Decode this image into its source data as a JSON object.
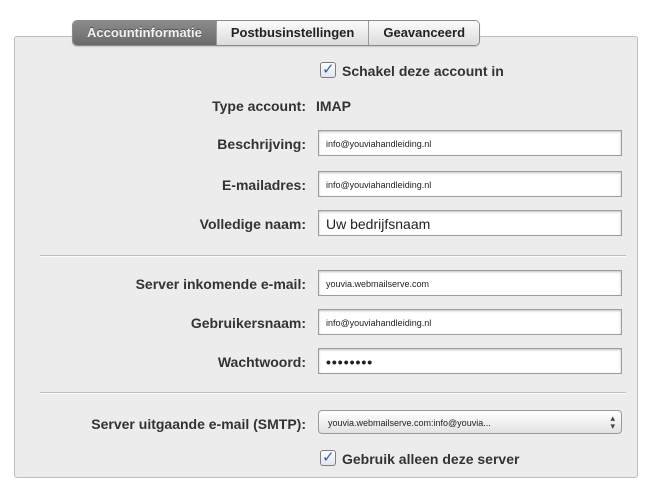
{
  "tabs": [
    {
      "label": "Accountinformatie",
      "active": true
    },
    {
      "label": "Postbusinstellingen",
      "active": false
    },
    {
      "label": "Geavanceerd",
      "active": false
    }
  ],
  "enable_account": {
    "label": "Schakel deze account in",
    "checked": true
  },
  "account_type": {
    "label": "Type account:",
    "value": "IMAP"
  },
  "description": {
    "label": "Beschrijving:",
    "value": "info@youviahandleiding.nl"
  },
  "email": {
    "label": "E-mailadres:",
    "value": "info@youviahandleiding.nl"
  },
  "full_name": {
    "label": "Volledige naam:",
    "value": "Uw bedrijfsnaam"
  },
  "incoming_server": {
    "label": "Server inkomende e-mail:",
    "value": "youvia.webmailserve.com"
  },
  "username": {
    "label": "Gebruikersnaam:",
    "value": "info@youviahandleiding.nl"
  },
  "password": {
    "label": "Wachtwoord:",
    "value": "••••••••"
  },
  "outgoing_server": {
    "label": "Server uitgaande e-mail (SMTP):",
    "value": "youvia.webmailserve.com:info@youvia..."
  },
  "only_this_server": {
    "label": "Gebruik alleen deze server",
    "checked": true
  },
  "colors": {
    "panel": "#ececec",
    "active_tab": "#7a7a7a",
    "checkmark": "#2f5fb5"
  }
}
